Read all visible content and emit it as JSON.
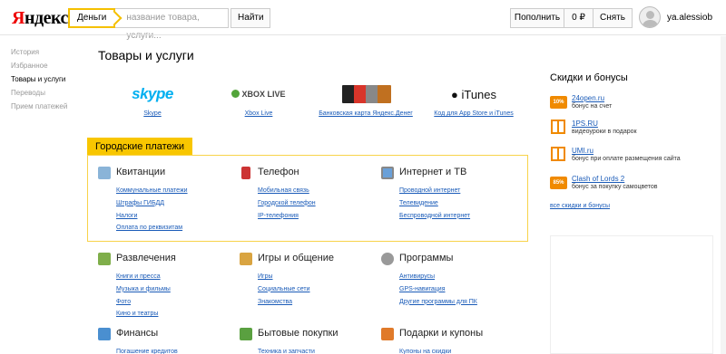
{
  "header": {
    "logo": "Яндекс",
    "search_tab": "Деньги",
    "search_placeholder": "название товара, услуги...",
    "search_button": "Найти",
    "topup_label": "Пополнить",
    "balance": "0 ₽",
    "withdraw_label": "Снять",
    "username": "ya.alessiob"
  },
  "nav": {
    "items": [
      "История",
      "Избранное",
      "Товары и услуги",
      "Переводы",
      "Прием платежей"
    ],
    "active_index": 2
  },
  "main": {
    "title": "Товары и услуги",
    "partners": [
      {
        "logo": "skype",
        "label": "Skype"
      },
      {
        "logo": "XBOX LIVE",
        "label": "Xbox Live"
      },
      {
        "label": "Банковская карта Яндекс.Денег"
      },
      {
        "logo": "iTunes",
        "label": "Код для App Store и iTunes"
      }
    ],
    "city_payments_label": "Городские платежи",
    "sections": [
      {
        "title": "Квитанции",
        "icon": "receipt-icon",
        "items": [
          "Коммунальные платежи",
          "Штрафы ГИБДД",
          "Налоги",
          "Оплата по реквизитам"
        ]
      },
      {
        "title": "Телефон",
        "icon": "phone-icon",
        "items": [
          "Мобильная связь",
          "Городской телефон",
          "IP-телефония"
        ]
      },
      {
        "title": "Интернет и ТВ",
        "icon": "monitor-icon",
        "items": [
          "Проводной интернет",
          "Телевидение",
          "Беспроводной интернет"
        ]
      },
      {
        "title": "Развлечения",
        "icon": "entertainment-icon",
        "items": [
          "Книги и пресса",
          "Музыка и фильмы",
          "Фото",
          "Кино и театры"
        ]
      },
      {
        "title": "Игры и общение",
        "icon": "games-icon",
        "items": [
          "Игры",
          "Социальные сети",
          "Знакомства"
        ]
      },
      {
        "title": "Программы",
        "icon": "programs-icon",
        "items": [
          "Антивирусы",
          "GPS-навигация",
          "Другие программы для ПК"
        ]
      },
      {
        "title": "Финансы",
        "icon": "finance-icon",
        "items": [
          "Погашение кредитов"
        ]
      },
      {
        "title": "Бытовые покупки",
        "icon": "shopping-icon",
        "items": [
          "Техника и запчасти"
        ]
      },
      {
        "title": "Подарки и купоны",
        "icon": "gift-icon",
        "items": [
          "Купоны на скидки"
        ]
      }
    ]
  },
  "bonuses": {
    "title": "Скидки и бонусы",
    "items": [
      {
        "badge": "10%",
        "name": "24open.ru",
        "desc": "бонус на счет"
      },
      {
        "badge": "",
        "name": "1PS.RU",
        "desc": "видеоуроки в подарок"
      },
      {
        "badge": "",
        "name": "UMI.ru",
        "desc": "бонус при оплате размещения сайта"
      },
      {
        "badge": "85%",
        "name": "Clash of Lords 2",
        "desc": "бонус за покупку самоцветов"
      }
    ],
    "all_link": "все скидки и бонусы"
  },
  "colors": {
    "accent_yellow": "#f8c600",
    "link_blue": "#1a5bb8",
    "badge_orange": "#f08a00"
  }
}
